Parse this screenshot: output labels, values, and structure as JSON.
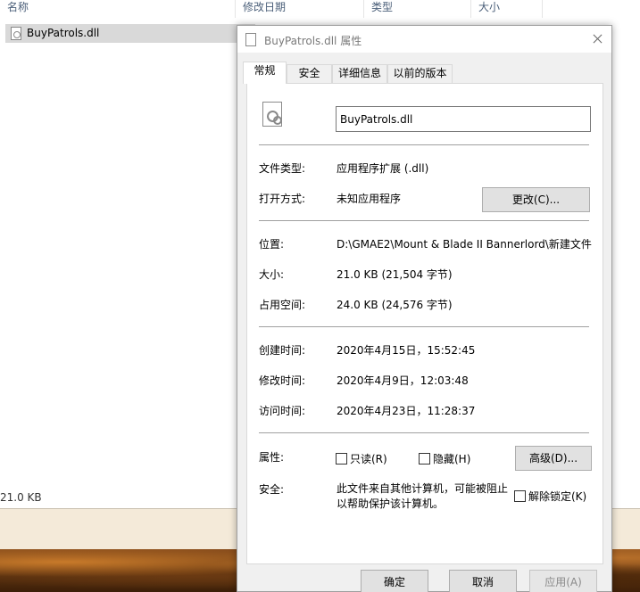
{
  "explorer": {
    "columns": [
      "名称",
      "修改日期",
      "类型",
      "大小"
    ],
    "selected_file": "BuyPatrols.dll",
    "status_size": "21.0 KB"
  },
  "dialog": {
    "title": "BuyPatrols.dll 属性",
    "tabs": [
      "常规",
      "安全",
      "详细信息",
      "以前的版本"
    ],
    "file_name": "BuyPatrols.dll",
    "rows": {
      "type_label": "文件类型:",
      "type_value": "应用程序扩展 (.dll)",
      "open_label": "打开方式:",
      "open_value": "未知应用程序",
      "change_button": "更改(C)...",
      "location_label": "位置:",
      "location_value": "D:\\GMAE2\\Mount & Blade II Bannerlord\\新建文件",
      "size_label": "大小:",
      "size_value": "21.0 KB (21,504 字节)",
      "disk_label": "占用空间:",
      "disk_value": "24.0 KB (24,576 字节)",
      "created_label": "创建时间:",
      "created_value": "2020年4月15日，15:52:45",
      "modified_label": "修改时间:",
      "modified_value": "2020年4月9日，12:03:48",
      "accessed_label": "访问时间:",
      "accessed_value": "2020年4月23日，11:28:37",
      "attr_label": "属性:",
      "readonly_label": "只读(R)",
      "hidden_label": "隐藏(H)",
      "advanced_button": "高级(D)...",
      "security_label": "安全:",
      "security_text_1": "此文件来自其他计算机，可能被阻止",
      "security_text_2": "以帮助保护该计算机。",
      "unblock_label": "解除锁定(K)"
    },
    "footer": {
      "ok": "确定",
      "cancel": "取消",
      "apply": "应用(A)"
    }
  }
}
